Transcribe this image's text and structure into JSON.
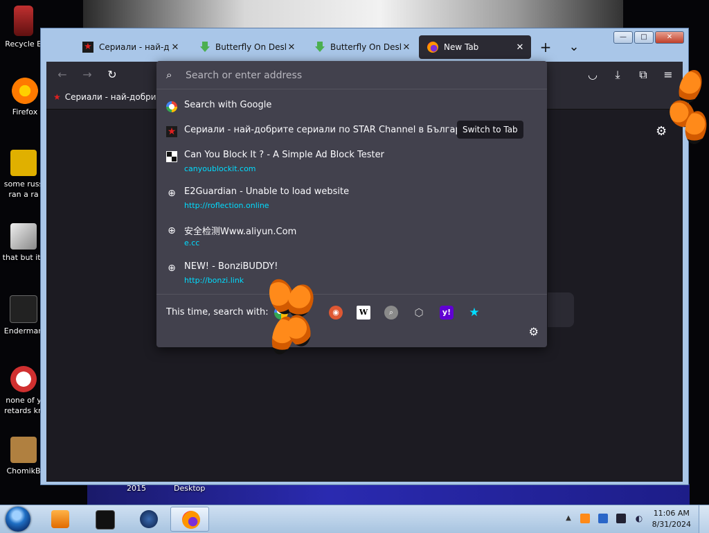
{
  "desktop": {
    "icons": [
      {
        "label": "Recycle B"
      },
      {
        "label": "Firefox"
      },
      {
        "label": "some russ\nran a ra"
      },
      {
        "label": "that but its"
      },
      {
        "label": "Enderman"
      },
      {
        "label": "none of y\nretards kn"
      },
      {
        "label": "ChomikB"
      }
    ],
    "bottom_labels": [
      "2015",
      "Desktop"
    ]
  },
  "window": {
    "controls": {
      "minimize": "—",
      "maximize": "□",
      "close": "✕"
    }
  },
  "tabs": [
    {
      "label": "Сериали - най-добр",
      "favicon": "star-icon",
      "active": false
    },
    {
      "label": "Butterfly On Desktop",
      "favicon": "download-arrow-icon",
      "active": false
    },
    {
      "label": "Butterfly On Desktop",
      "favicon": "download-arrow-icon",
      "active": false
    },
    {
      "label": "New Tab",
      "favicon": "firefox-icon",
      "active": true
    }
  ],
  "tabstrip": {
    "new_tab": "+",
    "list_all": "⌄"
  },
  "toolbar": {
    "back": "←",
    "forward": "→",
    "reload": "↻"
  },
  "bookmarks": [
    {
      "label": "Сериали - най-добри..."
    }
  ],
  "urlbar": {
    "placeholder": "Search or enter address",
    "results": [
      {
        "type": "search",
        "icon": "google-icon",
        "title": "Search with Google"
      },
      {
        "type": "switch",
        "icon": "star-icon",
        "title": "Сериали - най-добрите сериали по STAR Channel в България",
        "action": "Switch to Tab"
      },
      {
        "type": "history",
        "icon": "checker-icon",
        "title": "Can You Block It ? - A Simple Ad Block Tester",
        "url": "canyoublockit.com"
      },
      {
        "type": "history",
        "icon": "globe-icon",
        "title": "E2Guardian - Unable to load website",
        "url": "http://roflection.online"
      },
      {
        "type": "history",
        "icon": "globe-icon",
        "title": "安全检测Www.aliyun.Com",
        "url": "e.cc"
      },
      {
        "type": "history",
        "icon": "globe-icon",
        "title": "NEW! - BonziBUDDY!",
        "url": "http://bonzi.link"
      }
    ],
    "oneoff_label": "This time, search with:",
    "engines": [
      {
        "name": "google-icon",
        "glyph": "G",
        "color": "#ffffff"
      },
      {
        "name": "duckduckgo-icon",
        "glyph": "◉",
        "color": "#de5833"
      },
      {
        "name": "wikipedia-icon",
        "glyph": "W",
        "color": "#ffffff"
      },
      {
        "name": "search-engine-icon",
        "glyph": "⌕",
        "color": "#9a9a9a"
      },
      {
        "name": "tabs-icon",
        "glyph": "⬡",
        "color": "#d0d0d0"
      },
      {
        "name": "yahoo-icon",
        "glyph": "y!",
        "color": "#6001d2"
      },
      {
        "name": "bookmarks-star-icon",
        "glyph": "★",
        "color": "#00ddff"
      }
    ]
  },
  "taskbar": {
    "clock_time": "11:06 AM",
    "clock_date": "8/31/2024"
  }
}
